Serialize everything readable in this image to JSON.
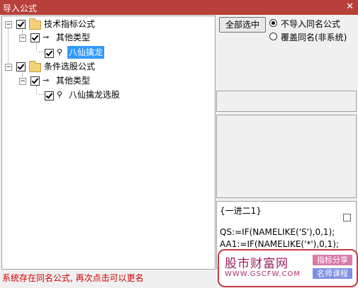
{
  "window": {
    "title": "导入公式",
    "close_glyph": "✕"
  },
  "tree": {
    "root1": {
      "label": "技术指标公式",
      "child": {
        "label": "其他类型",
        "leaf": "八仙擒龙"
      }
    },
    "root2": {
      "label": "条件选股公式",
      "child": {
        "label": "其他类型",
        "leaf": "八仙擒龙选股"
      }
    }
  },
  "toolbar": {
    "select_all": "全部选中"
  },
  "options": {
    "no_import_same": "不导入同名公式",
    "overwrite_same": "覆盖同名(非系统)",
    "selected": "no_import_same"
  },
  "code": {
    "lines": [
      "{一进二1}",
      "",
      "QS:=IF(NAMELIKE('S'),0,1);",
      "AA1:=IF(NAMELIKE('*'),0,1);"
    ]
  },
  "watermark": {
    "name": "股市财富网",
    "url": "WWW.GSCFW.COM",
    "tag1": "指标分享",
    "tag2": "名师课程"
  },
  "status": {
    "message": "系统存在同名公式, 再次点击可以更名"
  },
  "colors": {
    "titlebar": "#b8403a",
    "selection": "#3399ff",
    "status": "#d00000"
  }
}
